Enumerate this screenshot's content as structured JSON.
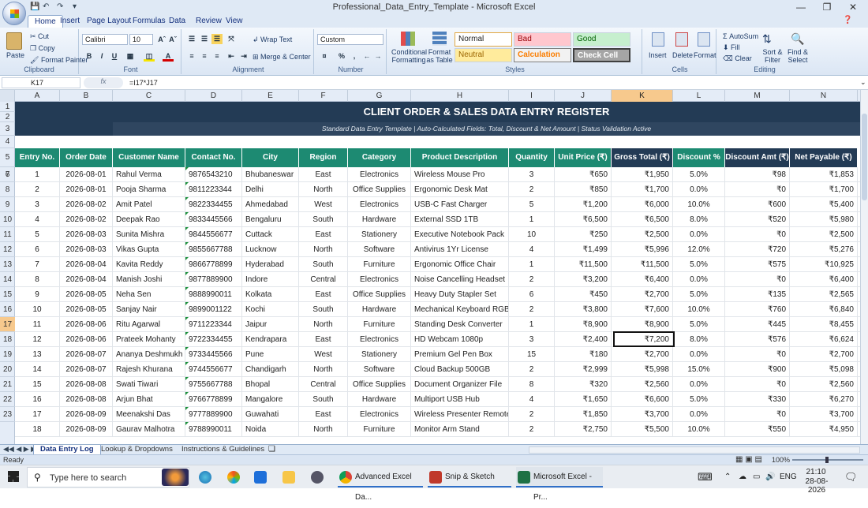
{
  "window": {
    "title": "Professional_Data_Entry_Template - Microsoft Excel"
  },
  "ribbon": {
    "tabs": [
      "Home",
      "Insert",
      "Page Layout",
      "Formulas",
      "Data",
      "Review",
      "View"
    ],
    "clipboard": {
      "paste": "Paste",
      "cut": "Cut",
      "copy": "Copy",
      "format_painter": "Format Painter",
      "label": "Clipboard"
    },
    "font": {
      "name": "Calibri",
      "size": "10",
      "label": "Font"
    },
    "alignment": {
      "wrap": "Wrap Text",
      "merge": "Merge & Center",
      "label": "Alignment"
    },
    "number": {
      "format": "Custom",
      "pct": "%",
      "comma": ",",
      "label": "Number"
    },
    "styles": {
      "cond_fmt": "Conditional Formatting",
      "format_table": "Format as Table",
      "normal": "Normal",
      "bad": "Bad",
      "good": "Good",
      "neutral": "Neutral",
      "calculation": "Calculation",
      "check_cell": "Check Cell",
      "label": "Styles"
    },
    "cells": {
      "insert": "Insert",
      "delete": "Delete",
      "format": "Format",
      "label": "Cells"
    },
    "editing": {
      "autosum": "AutoSum",
      "fill": "Fill",
      "clear": "Clear",
      "sort": "Sort & Filter",
      "find": "Find & Select",
      "label": "Editing"
    }
  },
  "formula_bar": {
    "name_box": "K17",
    "formula": "=I17*J17",
    "fx": "fx"
  },
  "columns": [
    "A",
    "B",
    "C",
    "D",
    "E",
    "F",
    "G",
    "H",
    "I",
    "J",
    "K",
    "L",
    "M",
    "N"
  ],
  "sheet": {
    "title": "CLIENT ORDER & SALES DATA ENTRY REGISTER",
    "subtitle": "Standard Data Entry Template  |  Auto-Calculated Fields: Total, Discount & Net Amount  |  Status Validation Active",
    "headers": [
      "Entry No.",
      "Order Date",
      "Customer Name",
      "Contact No.",
      "City",
      "Region",
      "Category",
      "Product Description",
      "Quantity",
      "Unit Price (₹)",
      "Gross Total (₹)",
      "Discount %",
      "Discount Amt (₹)",
      "Net Payable (₹)"
    ],
    "rows": [
      [
        "1",
        "2026-08-01",
        "Rahul Verma",
        "9876543210",
        "Bhubaneswar",
        "East",
        "Electronics",
        "Wireless Mouse Pro",
        "3",
        "₹650",
        "₹1,950",
        "5.0%",
        "₹98",
        "₹1,853"
      ],
      [
        "2",
        "2026-08-01",
        "Pooja Sharma",
        "9811223344",
        "Delhi",
        "North",
        "Office Supplies",
        "Ergonomic Desk Mat",
        "2",
        "₹850",
        "₹1,700",
        "0.0%",
        "₹0",
        "₹1,700"
      ],
      [
        "3",
        "2026-08-02",
        "Amit Patel",
        "9822334455",
        "Ahmedabad",
        "West",
        "Electronics",
        "USB-C Fast Charger",
        "5",
        "₹1,200",
        "₹6,000",
        "10.0%",
        "₹600",
        "₹5,400"
      ],
      [
        "4",
        "2026-08-02",
        "Deepak Rao",
        "9833445566",
        "Bengaluru",
        "South",
        "Hardware",
        "External SSD 1TB",
        "1",
        "₹6,500",
        "₹6,500",
        "8.0%",
        "₹520",
        "₹5,980"
      ],
      [
        "5",
        "2026-08-03",
        "Sunita Mishra",
        "9844556677",
        "Cuttack",
        "East",
        "Stationery",
        "Executive Notebook Pack",
        "10",
        "₹250",
        "₹2,500",
        "0.0%",
        "₹0",
        "₹2,500"
      ],
      [
        "6",
        "2026-08-03",
        "Vikas Gupta",
        "9855667788",
        "Lucknow",
        "North",
        "Software",
        "Antivirus 1Yr License",
        "4",
        "₹1,499",
        "₹5,996",
        "12.0%",
        "₹720",
        "₹5,276"
      ],
      [
        "7",
        "2026-08-04",
        "Kavita Reddy",
        "9866778899",
        "Hyderabad",
        "South",
        "Furniture",
        "Ergonomic Office Chair",
        "1",
        "₹11,500",
        "₹11,500",
        "5.0%",
        "₹575",
        "₹10,925"
      ],
      [
        "8",
        "2026-08-04",
        "Manish Joshi",
        "9877889900",
        "Indore",
        "Central",
        "Electronics",
        "Noise Cancelling Headset",
        "2",
        "₹3,200",
        "₹6,400",
        "0.0%",
        "₹0",
        "₹6,400"
      ],
      [
        "9",
        "2026-08-05",
        "Neha Sen",
        "9888990011",
        "Kolkata",
        "East",
        "Office Supplies",
        "Heavy Duty Stapler Set",
        "6",
        "₹450",
        "₹2,700",
        "5.0%",
        "₹135",
        "₹2,565"
      ],
      [
        "10",
        "2026-08-05",
        "Sanjay Nair",
        "9899001122",
        "Kochi",
        "South",
        "Hardware",
        "Mechanical Keyboard RGB",
        "2",
        "₹3,800",
        "₹7,600",
        "10.0%",
        "₹760",
        "₹6,840"
      ],
      [
        "11",
        "2026-08-06",
        "Ritu Agarwal",
        "9711223344",
        "Jaipur",
        "North",
        "Furniture",
        "Standing Desk Converter",
        "1",
        "₹8,900",
        "₹8,900",
        "5.0%",
        "₹445",
        "₹8,455"
      ],
      [
        "12",
        "2026-08-06",
        "Prateek Mohanty",
        "9722334455",
        "Kendrapara",
        "East",
        "Electronics",
        "HD Webcam 1080p",
        "3",
        "₹2,400",
        "₹7,200",
        "8.0%",
        "₹576",
        "₹6,624"
      ],
      [
        "13",
        "2026-08-07",
        "Ananya Deshmukh",
        "9733445566",
        "Pune",
        "West",
        "Stationery",
        "Premium Gel Pen Box",
        "15",
        "₹180",
        "₹2,700",
        "0.0%",
        "₹0",
        "₹2,700"
      ],
      [
        "14",
        "2026-08-07",
        "Rajesh Khurana",
        "9744556677",
        "Chandigarh",
        "North",
        "Software",
        "Cloud Backup 500GB",
        "2",
        "₹2,999",
        "₹5,998",
        "15.0%",
        "₹900",
        "₹5,098"
      ],
      [
        "15",
        "2026-08-08",
        "Swati Tiwari",
        "9755667788",
        "Bhopal",
        "Central",
        "Office Supplies",
        "Document Organizer File",
        "8",
        "₹320",
        "₹2,560",
        "0.0%",
        "₹0",
        "₹2,560"
      ],
      [
        "16",
        "2026-08-08",
        "Arjun Bhat",
        "9766778899",
        "Mangalore",
        "South",
        "Hardware",
        "Multiport USB Hub",
        "4",
        "₹1,650",
        "₹6,600",
        "5.0%",
        "₹330",
        "₹6,270"
      ],
      [
        "17",
        "2026-08-09",
        "Meenakshi Das",
        "9777889900",
        "Guwahati",
        "East",
        "Electronics",
        "Wireless Presenter Remote",
        "2",
        "₹1,850",
        "₹3,700",
        "0.0%",
        "₹0",
        "₹3,700"
      ],
      [
        "18",
        "2026-08-09",
        "Gaurav Malhotra",
        "9788990011",
        "Noida",
        "North",
        "Furniture",
        "Monitor Arm Stand",
        "2",
        "₹2,750",
        "₹5,500",
        "10.0%",
        "₹550",
        "₹4,950"
      ]
    ],
    "row_numbers": [
      "1",
      "2",
      "3",
      "4",
      "5",
      "6",
      "7",
      "8",
      "9",
      "10",
      "11",
      "12",
      "13",
      "14",
      "15",
      "16",
      "17",
      "18",
      "19",
      "20",
      "21",
      "22",
      "23"
    ]
  },
  "sheet_tabs": [
    "Data Entry Log",
    "Lookup & Dropdowns",
    "Instructions & Guidelines"
  ],
  "status": {
    "text": "Ready",
    "zoom": "100%"
  },
  "taskbar": {
    "search": "Type here to search",
    "apps": [
      "Advanced Excel Da...",
      "Snip & Sketch",
      "Microsoft Excel - Pr..."
    ],
    "lang": "ENG",
    "time": "21:10",
    "date": "28-08-2026"
  },
  "colors": {
    "header_green": "#1d8a72",
    "header_dark": "#233b55",
    "title_bg": "#233b55"
  }
}
